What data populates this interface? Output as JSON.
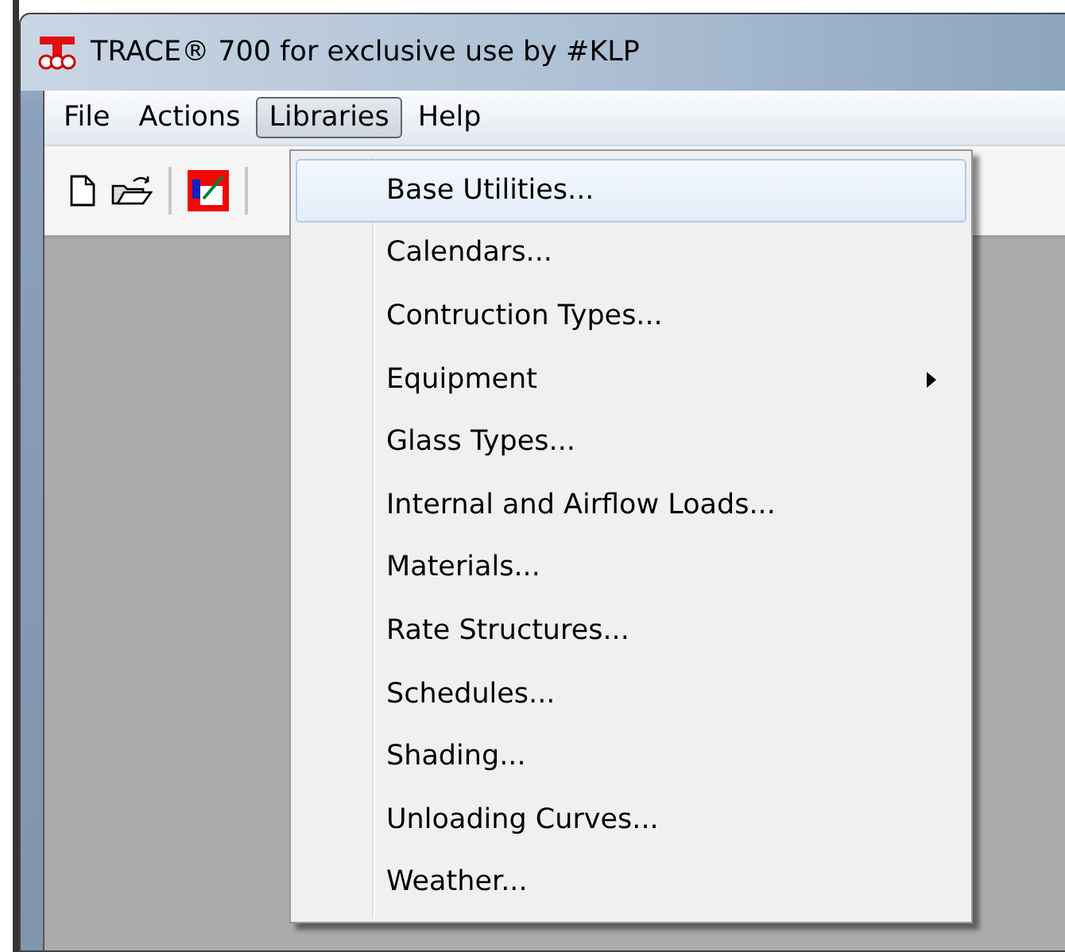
{
  "window": {
    "title": "TRACE® 700 for exclusive use by #KLP"
  },
  "menu_bar": [
    {
      "label": "File",
      "selected": false
    },
    {
      "label": "Actions",
      "selected": false
    },
    {
      "label": "Libraries",
      "selected": true
    },
    {
      "label": "Help",
      "selected": false
    }
  ],
  "libraries_menu": [
    {
      "label": "Base Utilities...",
      "selected": true,
      "submenu": false
    },
    {
      "label": "Calendars...",
      "selected": false,
      "submenu": false
    },
    {
      "label": "Contruction Types...",
      "selected": false,
      "submenu": false
    },
    {
      "label": "Equipment",
      "selected": false,
      "submenu": true
    },
    {
      "label": "Glass Types...",
      "selected": false,
      "submenu": false
    },
    {
      "label": "Internal and Airflow Loads...",
      "selected": false,
      "submenu": false
    },
    {
      "label": "Materials...",
      "selected": false,
      "submenu": false
    },
    {
      "label": "Rate Structures...",
      "selected": false,
      "submenu": false
    },
    {
      "label": "Schedules...",
      "selected": false,
      "submenu": false
    },
    {
      "label": "Shading...",
      "selected": false,
      "submenu": false
    },
    {
      "label": "Unloading Curves...",
      "selected": false,
      "submenu": false
    },
    {
      "label": "Weather...",
      "selected": false,
      "submenu": false
    }
  ]
}
